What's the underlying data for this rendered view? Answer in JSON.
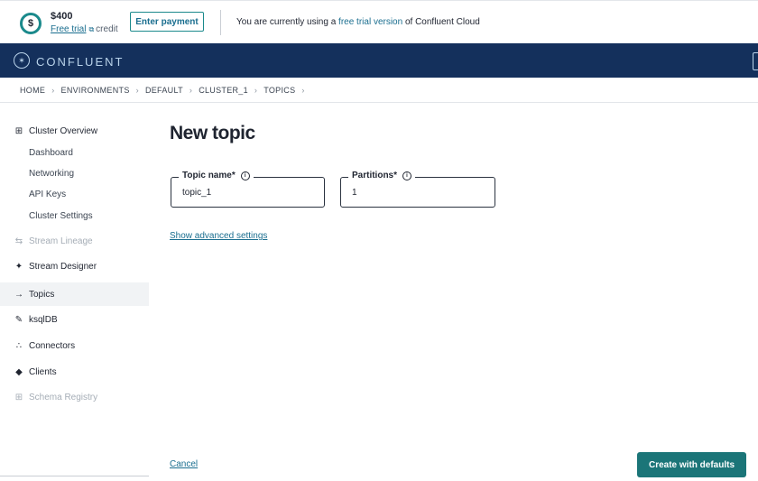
{
  "banner": {
    "credit_symbol": "$",
    "credit_amount": "$400",
    "trial_link": "Free trial",
    "credit_suffix": "credit",
    "enter_payment_label": "Enter payment",
    "message_prefix": "You are currently using a ",
    "message_link": "free trial version",
    "message_suffix": " of Confluent Cloud"
  },
  "brand": {
    "logo_text": "CONFLUENT",
    "color": "#14305c"
  },
  "breadcrumb": [
    "HOME",
    "ENVIRONMENTS",
    "DEFAULT",
    "CLUSTER_1",
    "TOPICS"
  ],
  "sidebar": {
    "items": [
      {
        "label": "Cluster Overview",
        "icon": "grid-icon"
      },
      {
        "label": "Dashboard"
      },
      {
        "label": "Networking"
      },
      {
        "label": "API Keys"
      },
      {
        "label": "Cluster Settings"
      },
      {
        "label": "Stream Lineage",
        "icon": "lineage-icon",
        "disabled": true
      },
      {
        "label": "Stream Designer",
        "icon": "designer-icon"
      },
      {
        "label": "Topics",
        "icon": "topics-icon",
        "selected": true
      },
      {
        "label": "ksqlDB",
        "icon": "ksqldb-icon"
      },
      {
        "label": "Connectors",
        "icon": "connectors-icon"
      },
      {
        "label": "Clients",
        "icon": "clients-icon"
      },
      {
        "label": "Schema Registry",
        "icon": "schema-icon",
        "disabled": true
      }
    ]
  },
  "main": {
    "title": "New topic",
    "topic_name_label": "Topic name*",
    "topic_name_value": "topic_1",
    "partitions_label": "Partitions*",
    "partitions_value": "1",
    "advanced_link": "Show advanced settings",
    "cancel_label": "Cancel",
    "create_label": "Create with defaults"
  },
  "colors": {
    "accent": "#1b7578",
    "link": "#1a6e8f"
  }
}
